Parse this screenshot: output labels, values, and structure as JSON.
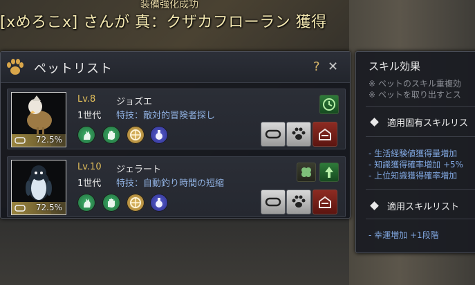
{
  "banner": {
    "small": "装備強化成功",
    "main": "[xめろこx] さんが 真：クザカフローラン 獲得"
  },
  "window": {
    "title": "ペットリスト",
    "help": "?",
    "close": "✕"
  },
  "pets": [
    {
      "level": "Lv.8",
      "name": "ジョズエ",
      "generation": "1世代",
      "talent": "特技：敵対的冒険者探し",
      "feed": "72.5%",
      "feed_value": 0.725
    },
    {
      "level": "Lv.10",
      "name": "ジェラート",
      "generation": "1世代",
      "talent": "特技：自動釣り時間の短縮",
      "feed": "72.5%",
      "feed_value": 0.725
    }
  ],
  "skill_panel": {
    "title": "スキル効果",
    "notes": [
      "※ ペットのスキル重複効",
      "※ ペットを取り出すとス"
    ],
    "inherent_header": "適用固有スキルリス",
    "inherent_items": [
      "- 生活経験値獲得量増加",
      "- 知識獲得確率増加 +5%",
      "- 上位知識獲得確率増加"
    ],
    "applied_header": "適用スキルリスト",
    "applied_items": [
      "- 幸運増加 +1段階"
    ]
  },
  "colors": {
    "level": "#e4c15c",
    "talent": "#8fb0e0",
    "skill_green": "#2f9a55",
    "skill_gold": "#c9a04a",
    "skill_purple": "#3b3fa8",
    "release_red": "#8d2b22"
  },
  "icons": {
    "header": "paw-icon",
    "skills": [
      "cat-icon",
      "hand-icon",
      "compass-icon",
      "potion-icon"
    ],
    "actions": [
      "feed-bowl-icon",
      "paw-command-icon",
      "release-icon"
    ],
    "row1_badges": [
      "clock-tree-icon"
    ],
    "row2_badges": [
      "clover-icon",
      "tree-icon"
    ]
  }
}
